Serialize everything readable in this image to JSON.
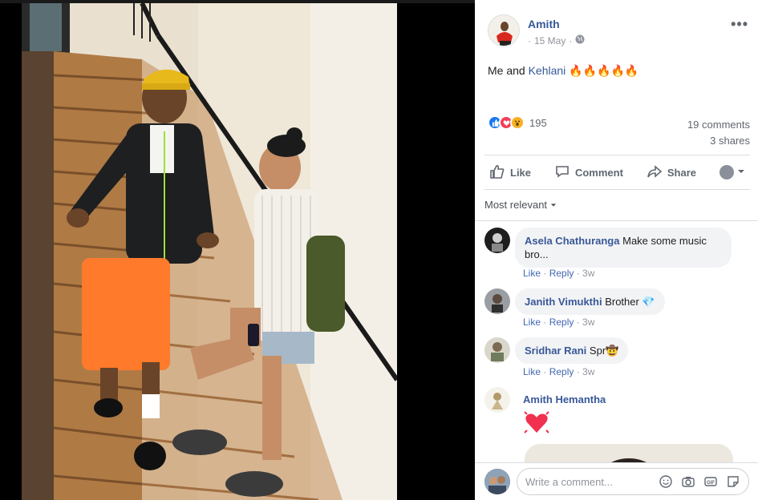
{
  "post": {
    "author": "Amith",
    "date": "15 May",
    "separator": "·",
    "text_prefix": "Me and ",
    "tagged": "Kehlani",
    "emoji": "🔥🔥🔥🔥🔥",
    "reaction_count": "195",
    "comments_count": "19 comments",
    "shares_count": "3 shares"
  },
  "actions": {
    "like": "Like",
    "comment": "Comment",
    "share": "Share"
  },
  "sort_label": "Most relevant",
  "comments": [
    {
      "name": "Asela Chathuranga",
      "text": "Make some music bro...",
      "like": "Like",
      "reply": "Reply",
      "time": "3w"
    },
    {
      "name": "Janith Vimukthi",
      "text": "Brother 💎",
      "like": "Like",
      "reply": "Reply",
      "time": "3w"
    },
    {
      "name": "Sridhar Rani",
      "text": "Spr🤠",
      "like": "Like",
      "reply": "Reply",
      "time": "3w"
    },
    {
      "name": "Amith Hemantha",
      "text": "",
      "like": "",
      "reply": "",
      "time": ""
    }
  ],
  "composer": {
    "placeholder": "Write a comment..."
  },
  "icons": {
    "globe": "globe-icon",
    "more": "more-options-icon",
    "like": "thumbs-up-icon",
    "comment": "speech-bubble-icon",
    "share": "share-arrow-icon",
    "caret": "caret-down-icon",
    "emoji": "smiley-icon",
    "camera": "camera-icon",
    "gif": "gif-icon",
    "sticker": "sticker-icon"
  },
  "colors": {
    "link": "#365899",
    "like_blue": "#1877f2",
    "love_red": "#f33e58",
    "wow_yellow": "#f7b125"
  }
}
